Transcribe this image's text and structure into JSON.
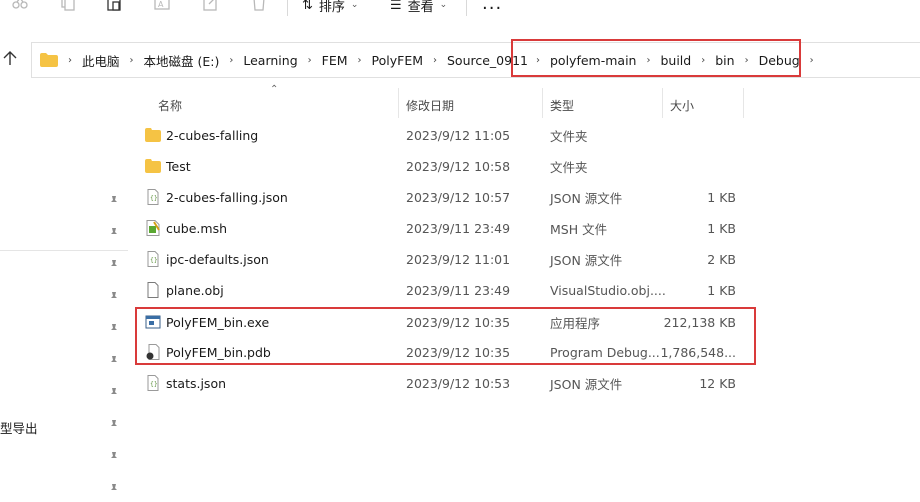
{
  "toolbar": {
    "sort_label": "排序",
    "view_label": "查看",
    "more_label": "···"
  },
  "breadcrumb": [
    "此电脑",
    "本地磁盘 (E:)",
    "Learning",
    "FEM",
    "PolyFEM",
    "Source_0911",
    "polyfem-main",
    "build",
    "bin",
    "Debug"
  ],
  "columns": {
    "name": "名称",
    "date": "修改日期",
    "type": "类型",
    "size": "大小"
  },
  "files": [
    {
      "name": "2-cubes-falling",
      "date": "2023/9/12 11:05",
      "type": "文件夹",
      "size": "",
      "icon": "folder-icon"
    },
    {
      "name": "Test",
      "date": "2023/9/12 10:58",
      "type": "文件夹",
      "size": "",
      "icon": "folder-icon"
    },
    {
      "name": "2-cubes-falling.json",
      "date": "2023/9/12 10:57",
      "type": "JSON 源文件",
      "size": "1 KB",
      "icon": "json-file-icon"
    },
    {
      "name": "cube.msh",
      "date": "2023/9/11 23:49",
      "type": "MSH 文件",
      "size": "1 KB",
      "icon": "msh-file-icon"
    },
    {
      "name": "ipc-defaults.json",
      "date": "2023/9/12 11:01",
      "type": "JSON 源文件",
      "size": "2 KB",
      "icon": "json-file-icon"
    },
    {
      "name": "plane.obj",
      "date": "2023/9/11 23:49",
      "type": "VisualStudio.obj....",
      "size": "1 KB",
      "icon": "obj-file-icon"
    },
    {
      "name": "PolyFEM_bin.exe",
      "date": "2023/9/12 10:35",
      "type": "应用程序",
      "size": "212,138 KB",
      "icon": "exe-file-icon"
    },
    {
      "name": "PolyFEM_bin.pdb",
      "date": "2023/9/12 10:35",
      "type": "Program Debug...",
      "size": "1,786,548...",
      "icon": "pdb-file-icon"
    },
    {
      "name": "stats.json",
      "date": "2023/9/12 10:53",
      "type": "JSON 源文件",
      "size": "12 KB",
      "icon": "json-file-icon"
    }
  ],
  "nav": {
    "partial_label": "型导出"
  },
  "colors": {
    "highlight": "#d93a3a",
    "folder": "#f5c344"
  }
}
